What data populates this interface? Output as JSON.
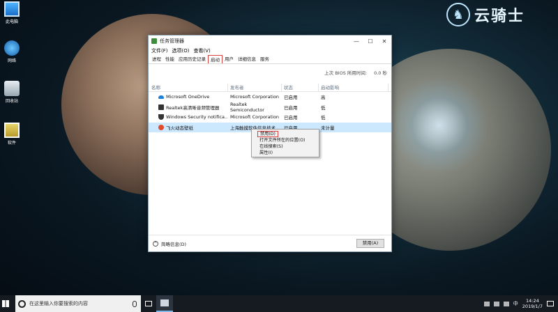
{
  "watermark": {
    "brand_text": "云骑士"
  },
  "desktop_icons": [
    {
      "label": "此电脑",
      "icon": "computer-icon"
    },
    {
      "label": "网络",
      "icon": "network-icon"
    },
    {
      "label": "回收站",
      "icon": "recycle-bin-icon"
    },
    {
      "label": "软件",
      "icon": "folder-icon"
    }
  ],
  "window": {
    "title": "任务管理器",
    "menu": [
      "文件(F)",
      "选项(O)",
      "查看(V)"
    ],
    "tabs": [
      "进程",
      "性能",
      "应用历史记录",
      "启动",
      "用户",
      "详细信息",
      "服务"
    ],
    "active_tab_index": 3,
    "bios_label": "上次 BIOS 所用时间:",
    "bios_value": "0.0 秒",
    "columns": [
      "名称",
      "发布者",
      "状态",
      "启动影响"
    ],
    "rows": [
      {
        "name": "Microsoft OneDrive",
        "publisher": "Microsoft Corporation",
        "status": "已启用",
        "impact": "高",
        "icon": "cloud-icon"
      },
      {
        "name": "Realtek高清晰音频管理器",
        "publisher": "Realtek Semiconductor",
        "status": "已启用",
        "impact": "低",
        "icon": "speaker-icon"
      },
      {
        "name": "Windows Security notifica...",
        "publisher": "Microsoft Corporation",
        "status": "已启用",
        "impact": "低",
        "icon": "shield-icon"
      },
      {
        "name": "飞火动态壁纸",
        "publisher": "上海触摸软件信息技术",
        "status": "已启用",
        "impact": "未计量",
        "icon": "app-icon"
      }
    ],
    "selected_row_index": 3,
    "footer_less_label": "简略信息(D)",
    "footer_button": "禁用(A)"
  },
  "context_menu": {
    "items": [
      "禁用(D)",
      "打开文件所在的位置(O)",
      "在线搜索(S)",
      "属性(I)"
    ],
    "highlighted_index": 0
  },
  "taskbar": {
    "search_placeholder": "在这里输入你要搜索的内容",
    "ime": "中",
    "time": "14:24",
    "date": "2019/1/7"
  }
}
